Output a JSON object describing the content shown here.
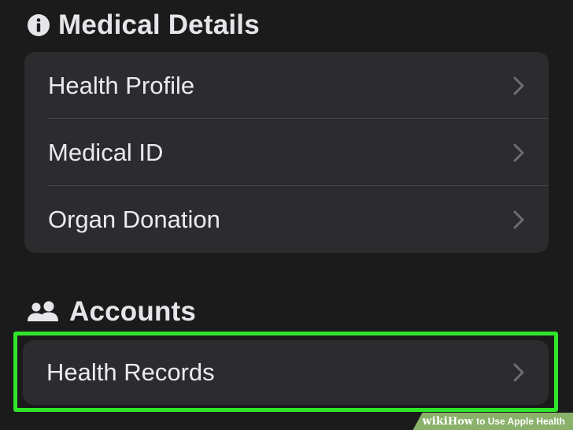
{
  "sections": {
    "medical": {
      "header": "Medical Details",
      "icon": "info-circle-icon",
      "items": [
        {
          "label": "Health Profile"
        },
        {
          "label": "Medical ID"
        },
        {
          "label": "Organ Donation"
        }
      ]
    },
    "accounts": {
      "header": "Accounts",
      "icon": "people-icon",
      "items": [
        {
          "label": "Health Records",
          "highlighted": true
        }
      ]
    }
  },
  "watermark": {
    "brand": "wiki",
    "how": "How",
    "title": "to Use Apple Health"
  },
  "colors": {
    "background": "#1b1b1c",
    "card": "#2c2c2e",
    "highlight": "#2fe52a",
    "chevron": "#6d6d72"
  }
}
